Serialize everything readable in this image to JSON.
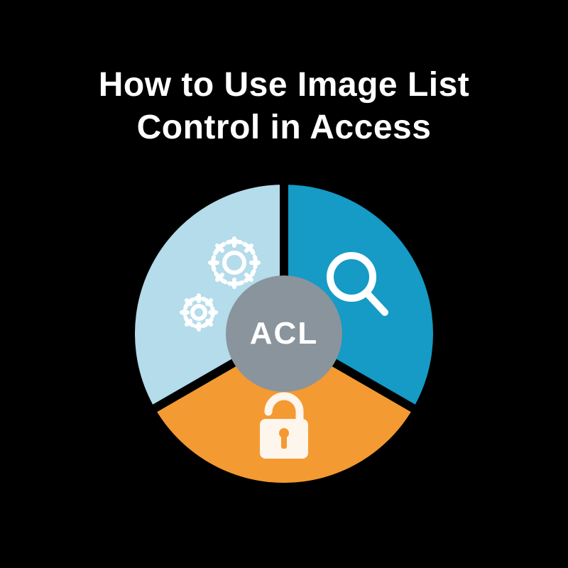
{
  "title": "How to Use Image List Control in Access",
  "diagram": {
    "center_label": "ACL",
    "center_color": "#8a949c",
    "separator_color": "#000000",
    "segments": [
      {
        "name": "top-left",
        "color": "#b4dceb",
        "icon": "gears-icon"
      },
      {
        "name": "top-right",
        "color": "#159bc5",
        "icon": "magnifier-icon"
      },
      {
        "name": "bottom",
        "color": "#f39a32",
        "icon": "lock-icon"
      }
    ]
  }
}
